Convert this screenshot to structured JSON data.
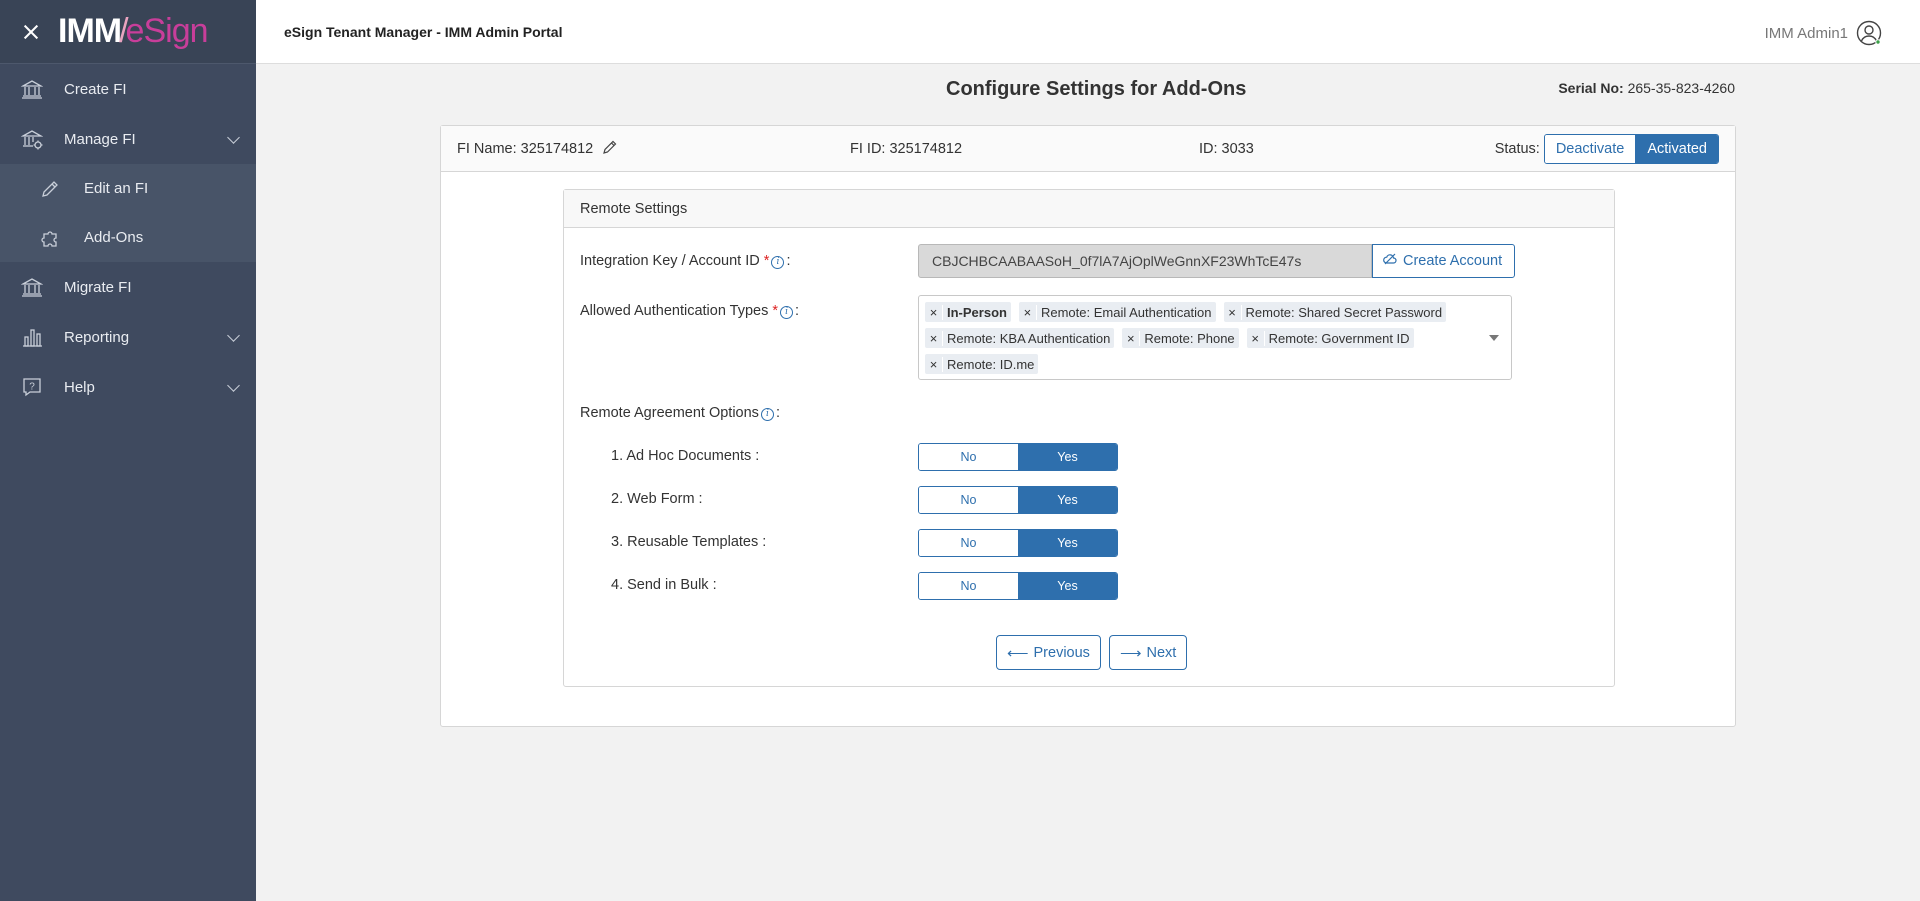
{
  "brand": {
    "imm": "IMM",
    "slash": "/",
    "esign": "eSign"
  },
  "sidebar": {
    "items": [
      {
        "label": "Create FI"
      },
      {
        "label": "Manage FI"
      },
      {
        "label": "Edit an FI"
      },
      {
        "label": "Add-Ons"
      },
      {
        "label": "Migrate FI"
      },
      {
        "label": "Reporting"
      },
      {
        "label": "Help"
      }
    ]
  },
  "header": {
    "title": "eSign Tenant Manager - IMM Admin Portal",
    "user": "IMM Admin1"
  },
  "main": {
    "title": "Configure Settings for Add-Ons",
    "serial_label": "Serial No:",
    "serial_value": "265-35-823-4260",
    "fi_name": "FI Name: 325174812",
    "fi_id": "FI ID: 325174812",
    "id": "ID: 3033",
    "status_label": "Status:",
    "deactivate": "Deactivate",
    "activated": "Activated"
  },
  "remote": {
    "section_title": "Remote Settings",
    "key_label": "Integration Key / Account ID",
    "req": "*",
    "colon": ":",
    "key_value": "CBJCHBCAABAASoH_0f7lA7AjOplWeGnnXF23WhTcE47s",
    "create_account": "Create Account",
    "auth_label": "Allowed Authentication Types",
    "tags": [
      "In-Person",
      "Remote: Email Authentication",
      "Remote: Shared Secret Password",
      "Remote: KBA Authentication",
      "Remote: Phone",
      "Remote: Government ID",
      "Remote: ID.me"
    ],
    "agreement_label": "Remote Agreement Options",
    "options": [
      {
        "label": "1. Ad Hoc Documents :",
        "no": "No",
        "yes": "Yes"
      },
      {
        "label": "2. Web Form :",
        "no": "No",
        "yes": "Yes"
      },
      {
        "label": "3. Reusable Templates :",
        "no": "No",
        "yes": "Yes"
      },
      {
        "label": "4. Send in Bulk :",
        "no": "No",
        "yes": "Yes"
      }
    ],
    "previous": "Previous",
    "next": "Next"
  },
  "colors": {
    "sidebar": "#3f4a5f",
    "accent": "#2e6fad",
    "required": "#dd2222",
    "brand_esign": "#c83e9a"
  },
  "icons": [
    "close-icon",
    "bank-icon",
    "bank-settings-icon",
    "pencil-icon",
    "puzzle-icon",
    "bar-chart-icon",
    "help-icon",
    "user-avatar-icon",
    "info-icon",
    "cloud-icon",
    "arrow-left-icon",
    "arrow-right-icon",
    "chevron-down-icon"
  ]
}
